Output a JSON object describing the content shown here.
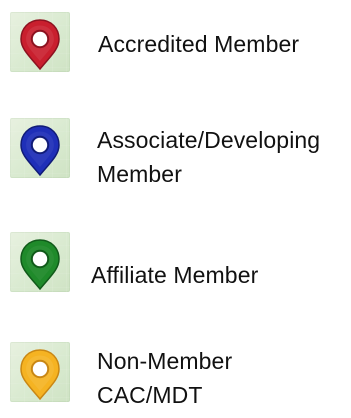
{
  "legend": {
    "items": [
      {
        "label_lines": [
          "Accredited Member"
        ],
        "marker_color": "#c91f2e",
        "marker_dark": "#8c1220",
        "icon": "map-pin-icon"
      },
      {
        "label_lines": [
          "Associate/Developing",
          "Member"
        ],
        "marker_color": "#1f2fb8",
        "marker_dark": "#111c78",
        "icon": "map-pin-icon"
      },
      {
        "label_lines": [
          "Affiliate Member"
        ],
        "marker_color": "#1f8a2a",
        "marker_dark": "#115a1a",
        "icon": "map-pin-icon"
      },
      {
        "label_lines": [
          "Non-Member",
          "CAC/MDT"
        ],
        "marker_color": "#f5b322",
        "marker_dark": "#c98714",
        "icon": "map-pin-icon"
      }
    ]
  }
}
